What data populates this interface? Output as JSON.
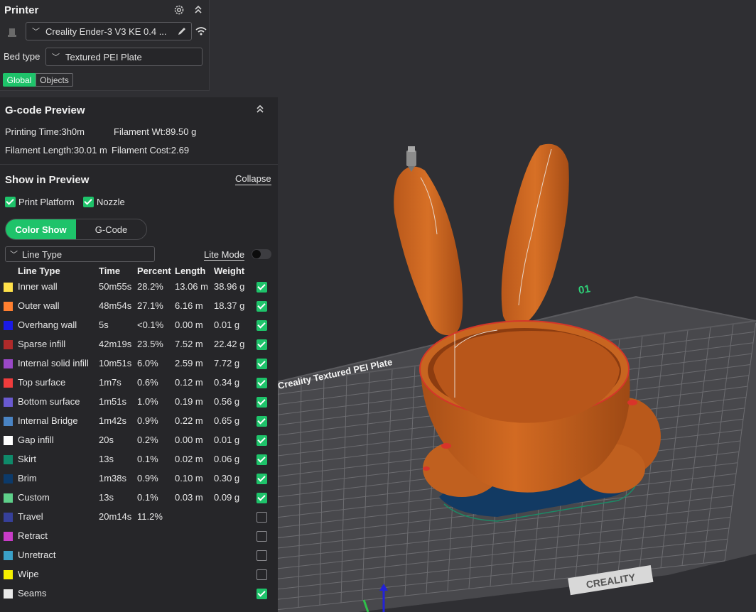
{
  "printer": {
    "title": "Printer",
    "printer_name": "Creality Ender-3 V3 KE 0.4 ...",
    "bed_type_label": "Bed type",
    "bed_type_value": "Textured PEI Plate",
    "tabs": [
      "Global",
      "Objects"
    ],
    "active_tab": "Global"
  },
  "gcode_preview": {
    "title": "G-code Preview",
    "printing_time": "Printing Time:3h0m",
    "filament_wt": "Filament Wt:89.50 g",
    "filament_length": "Filament Length:30.01 m",
    "filament_cost": "Filament Cost:2.69"
  },
  "show_in_preview": {
    "title": "Show in Preview",
    "collapse_label": "Collapse",
    "print_platform_label": "Print Platform",
    "print_platform_checked": true,
    "nozzle_label": "Nozzle",
    "nozzle_checked": true,
    "mode_tabs": [
      "Color Show",
      "G-Code"
    ],
    "active_mode": "Color Show",
    "view_select": "Line Type",
    "lite_mode_label": "Lite Mode",
    "lite_mode_on": false
  },
  "line_types": {
    "headers": [
      "Line Type",
      "Time",
      "Percent",
      "Length",
      "Weight"
    ],
    "rows": [
      {
        "name": "Inner wall",
        "color": "#ffe14a",
        "time": "50m55s",
        "percent": "28.2%",
        "length": "13.06 m",
        "weight": "38.96 g",
        "checked": true
      },
      {
        "name": "Outer wall",
        "color": "#ff7f30",
        "time": "48m54s",
        "percent": "27.1%",
        "length": "6.16 m",
        "weight": "18.37 g",
        "checked": true
      },
      {
        "name": "Overhang wall",
        "color": "#1a1ae6",
        "time": "5s",
        "percent": "<0.1%",
        "length": "0.00 m",
        "weight": "0.01 g",
        "checked": true
      },
      {
        "name": "Sparse infill",
        "color": "#b02a2a",
        "time": "42m19s",
        "percent": "23.5%",
        "length": "7.52 m",
        "weight": "22.42 g",
        "checked": true
      },
      {
        "name": "Internal solid infill",
        "color": "#9a48c8",
        "time": "10m51s",
        "percent": "6.0%",
        "length": "2.59 m",
        "weight": "7.72 g",
        "checked": true
      },
      {
        "name": "Top surface",
        "color": "#f03c3c",
        "time": "1m7s",
        "percent": "0.6%",
        "length": "0.12 m",
        "weight": "0.34 g",
        "checked": true
      },
      {
        "name": "Bottom surface",
        "color": "#6a5ad0",
        "time": "1m51s",
        "percent": "1.0%",
        "length": "0.19 m",
        "weight": "0.56 g",
        "checked": true
      },
      {
        "name": "Internal Bridge",
        "color": "#4a84c4",
        "time": "1m42s",
        "percent": "0.9%",
        "length": "0.22 m",
        "weight": "0.65 g",
        "checked": true
      },
      {
        "name": "Gap infill",
        "color": "#ffffff",
        "time": "20s",
        "percent": "0.2%",
        "length": "0.00 m",
        "weight": "0.01 g",
        "checked": true
      },
      {
        "name": "Skirt",
        "color": "#0f8a6a",
        "time": "13s",
        "percent": "0.1%",
        "length": "0.02 m",
        "weight": "0.06 g",
        "checked": true
      },
      {
        "name": "Brim",
        "color": "#0c3a6a",
        "time": "1m38s",
        "percent": "0.9%",
        "length": "0.10 m",
        "weight": "0.30 g",
        "checked": true
      },
      {
        "name": "Custom",
        "color": "#5ed08a",
        "time": "13s",
        "percent": "0.1%",
        "length": "0.03 m",
        "weight": "0.09 g",
        "checked": true
      },
      {
        "name": "Travel",
        "color": "#36409a",
        "time": "20m14s",
        "percent": "11.2%",
        "length": "",
        "weight": "",
        "checked": false
      },
      {
        "name": "Retract",
        "color": "#c83cc8",
        "time": "",
        "percent": "",
        "length": "",
        "weight": "",
        "checked": false
      },
      {
        "name": "Unretract",
        "color": "#3aa0c8",
        "time": "",
        "percent": "",
        "length": "",
        "weight": "",
        "checked": false
      },
      {
        "name": "Wipe",
        "color": "#f5f000",
        "time": "",
        "percent": "",
        "length": "",
        "weight": "",
        "checked": false
      },
      {
        "name": "Seams",
        "color": "#eaeaea",
        "time": "",
        "percent": "",
        "length": "",
        "weight": "",
        "checked": true
      }
    ]
  },
  "viewport": {
    "plate_label": "Creality Textured PEI Plate",
    "plate_number": "01",
    "bed_logo": "CREALITY"
  }
}
